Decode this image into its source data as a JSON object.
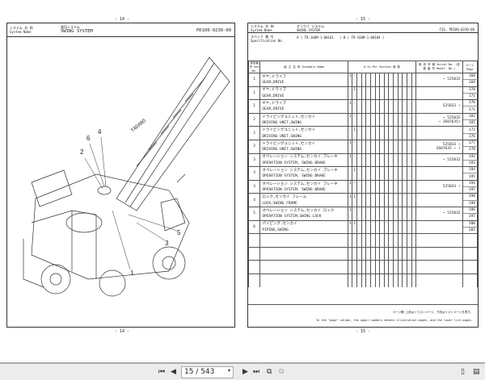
{
  "left_page": {
    "page_number": "- 14 -",
    "system_label_jp": "システム 名 称",
    "system_label_en": "System Name",
    "system_name_jp": "旋回システム",
    "system_name": "SWING SYSTEM",
    "fig_no": "PD100-0230-00",
    "bottom_page_number": "- 14 -",
    "callouts": [
      "1",
      "2",
      "3",
      "4",
      "5",
      "6"
    ],
    "logo": "TADANO"
  },
  "right_page": {
    "page_number": "- 15 -",
    "bottom_page_number": "- 15 -",
    "system_label_jp": "システム 名 称",
    "system_label_en": "System Name",
    "system_name_jp": "センカイ システム",
    "system_name": "SWING SYSTEM",
    "fig_label": "FIG.",
    "fig_no": "PD100-0230-00",
    "spec_label_jp": "スペック 番 号",
    "spec_label_en": "Specification No.",
    "spec_a": "A ( TR-160M-1-00101",
    "spec_b": ") B ( TR-160M-1-00104",
    "headers": {
      "key": "部品番号 Key No.",
      "assembly": "組 立 名 称  Assembly Name",
      "qty": "Q'ty Per Section 個 数",
      "cols": [
        "A",
        "B",
        "C",
        "D",
        "E",
        "F",
        "G",
        "H",
        "I",
        "J",
        "K",
        "L",
        "M",
        "N",
        "O"
      ],
      "serial": "適 用 号 機 Serial No. (変 更 番 号 Modif. No.)",
      "page": "ページ Page"
    },
    "rows": [
      {
        "key": "1",
        "jp": "ギヤ,ドライブ",
        "name": "GEAR,DRIVE",
        "a": "1",
        "b": "-",
        "serial": "~ 525032",
        "serial2": "",
        "p1": "168",
        "p2": "169"
      },
      {
        "key": "1",
        "jp": "ギヤ,ドライブ",
        "name": "GEAR,DRIVE",
        "a": "-",
        "b": "1",
        "serial": "",
        "serial2": "",
        "p1": "170",
        "p2": "171"
      },
      {
        "key": "1",
        "jp": "ギヤ,ドライブ",
        "name": "GEAR,DRIVE",
        "a": "1",
        "b": "-",
        "serial": "525033 ~",
        "serial2": "",
        "p1": "170",
        "p2": "171"
      },
      {
        "key": "2",
        "jp": "ドライビングユニット,センカイ",
        "name": "DRIVING UNIT,SWING",
        "a": "1",
        "b": "-",
        "serial": "~ 525032",
        "serial2": "~ 2607635)",
        "p1": "182",
        "p2": "185"
      },
      {
        "key": "2",
        "jp": "ドライビングユニット,センカイ",
        "name": "DRIVING UNIT,SWING",
        "a": "-",
        "b": "1",
        "serial": "",
        "serial2": "",
        "p1": "172",
        "p2": "176"
      },
      {
        "key": "2",
        "jp": "ドライビングユニット,センカイ",
        "name": "DRIVING UNIT,SWING",
        "a": "1",
        "b": "-",
        "serial": "525033 ~",
        "serial2": "2607635 ~   )",
        "p1": "177",
        "p2": "178"
      },
      {
        "key": "3",
        "jp": "オペレーション システム,センカイ ブレーキ",
        "name": "OPERATION SYSTEM, SWING BRAKE",
        "a": "1",
        "b": "-",
        "serial": "~ 525032",
        "serial2": "",
        "p1": "192",
        "p2": "193"
      },
      {
        "key": "3",
        "jp": "オペレーション システム,センカイ ブレーキ",
        "name": "OPERATION SYSTEM, SWING BRAKE",
        "a": "-",
        "b": "1",
        "serial": "",
        "serial2": "",
        "p1": "194",
        "p2": "195"
      },
      {
        "key": "3",
        "jp": "オペレーション システム,センカイ ブレーキ",
        "name": "OPERATION SYSTEM, SWING BRAKE",
        "a": "1",
        "b": "-",
        "serial": "525033 ~",
        "serial2": "",
        "p1": "194",
        "p2": "195"
      },
      {
        "key": "4",
        "jp": "ロック,センカイ フレーム",
        "name": "LOCK,SWING FRAME",
        "a": "1",
        "b": "1",
        "serial": "",
        "serial2": "",
        "p1": "198",
        "p2": "199"
      },
      {
        "key": "5",
        "jp": "オペレーション システム,センカイ ロック",
        "name": "OPERATION SYSTEM,SWING LOCK",
        "a": "1",
        "b": "-",
        "serial": "~ 525032",
        "serial2": "",
        "p1": "196",
        "p2": "197"
      },
      {
        "key": "6",
        "jp": "パイピング,センカイ",
        "name": "PIPING,SWING",
        "a": "1",
        "b": "1",
        "serial": "",
        "serial2": "",
        "p1": "200",
        "p2": "201"
      }
    ],
    "note_jp": "ページ欄 上段はイラストページ、下段はリストページを表す。",
    "note_en": "In the \"page\" column, the upper numbers denote illustration pages, and the lower list pages."
  },
  "toolbar": {
    "page_value": "15 / 543"
  }
}
